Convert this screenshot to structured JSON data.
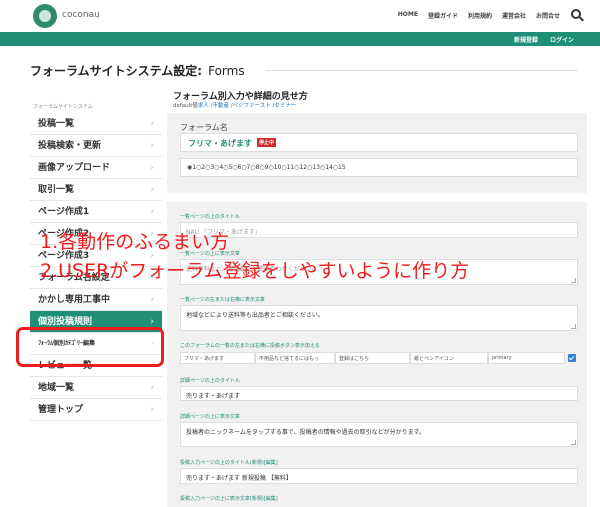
{
  "header": {
    "logo_text": "coconau",
    "nav": [
      "HOME",
      "登録ガイド",
      "利用規約",
      "運営会社",
      "お問合せ"
    ]
  },
  "greenbar": {
    "links": [
      "新規登録",
      "ログイン"
    ]
  },
  "page": {
    "title": "フォーラムサイトシステム設定:",
    "title_suffix": "Forms"
  },
  "sidebar": {
    "caption": "フォーラムサイトシステム",
    "items": [
      {
        "label": "投稿一覧"
      },
      {
        "label": "投稿検索・更新"
      },
      {
        "label": "画像アップロード"
      },
      {
        "label": "取引一覧"
      },
      {
        "label": "ページ作成1"
      },
      {
        "label": "ページ作成2"
      },
      {
        "label": "ページ作成3"
      },
      {
        "label": "フォーラム名設定"
      },
      {
        "label": "かかし専用工事中"
      },
      {
        "label": "個別投稿規則"
      },
      {
        "label": "ﾌｫｰﾗﾑ個別ｶﾃｺﾞﾘｰ編集"
      },
      {
        "label": "レビュー一覧"
      },
      {
        "label": "地域一覧"
      },
      {
        "label": "管理トップ"
      }
    ],
    "chevron": "›"
  },
  "section": {
    "heading": "フォーラム別入力や詳細の見せ方",
    "sub_prefix": "default値",
    "sub_links": "求人 /不動産 /ベジファースト /セミナー"
  },
  "forum": {
    "label": "フォーラム名",
    "name": "フリマ・あげます",
    "badge": "停止中",
    "radios": "◉1○2○3○4○5○6○7○8○9○10○11○12○13○14○15"
  },
  "fields": [
    {
      "label": "一覧ページの上のタイトル",
      "value": "NAU 「フリマ・あげます」"
    },
    {
      "label": "一覧ページの上に表示文章",
      "value": "送料無料など、お気軽にお問い合わせください。"
    },
    {
      "label": "一覧ページの左または右横に表示文章",
      "value": "地域などにより送料等も出品者とご相談ください。"
    },
    {
      "label": "このフォーラムの一覧の左または右横に投稿ボタン表示加える",
      "value": ""
    },
    {
      "label": "詳細ページの上のタイトル",
      "value": "売ります・あげます"
    },
    {
      "label": "詳細ページの上に表示文章",
      "value": "投稿者のニックネームをタップする事で、投稿者の情報や過去の取引などが分かります。"
    },
    {
      "label": "投稿入力ページの上のタイトル(新規)[編集]",
      "value": "売ります・あげます 新規投稿 【無料】"
    },
    {
      "label": "投稿入力ページの上に表示文章(新規)[編集]",
      "value": ""
    }
  ],
  "button_row": [
    "フリマ・あげます",
    "不用品など捨てるにはもっ",
    "登録はこちら",
    "紙とペンアイコン",
    "primary"
  ],
  "overlay": {
    "line1": "1.各動作のふるまい方",
    "line2": "2.USERがフォーラム登録をしやすいように作り方"
  }
}
